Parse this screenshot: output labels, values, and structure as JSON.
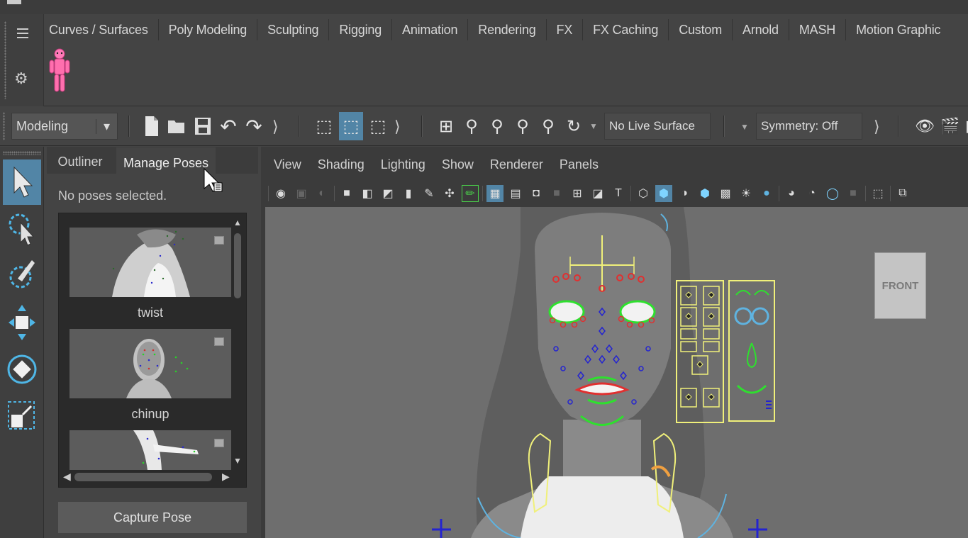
{
  "shelf": {
    "tabs": [
      "Curves / Surfaces",
      "Poly Modeling",
      "Sculpting",
      "Rigging",
      "Animation",
      "Rendering",
      "FX",
      "FX Caching",
      "Custom",
      "Arnold",
      "MASH",
      "Motion Graphic"
    ]
  },
  "status_line": {
    "menu_set": "Modeling",
    "live_surface": "No Live Surface",
    "symmetry": "Symmetry: Off"
  },
  "left_panel": {
    "tabs": [
      "Outliner",
      "Manage Poses"
    ],
    "active_tab": "Manage Poses",
    "status": "No poses selected.",
    "poses": [
      "twist",
      "chinup",
      ""
    ],
    "capture_button": "Capture Pose"
  },
  "viewport": {
    "menus": [
      "View",
      "Shading",
      "Lighting",
      "Show",
      "Renderer",
      "Panels"
    ],
    "view_cube_label": "FRONT"
  },
  "colors": {
    "accent_blue": "#4fb6e6",
    "selected_tool": "#5285a6",
    "ctrl_red": "#e03030",
    "ctrl_green": "#2ee02e",
    "ctrl_blue": "#2424d0",
    "ctrl_yellow": "#f0f07a"
  }
}
